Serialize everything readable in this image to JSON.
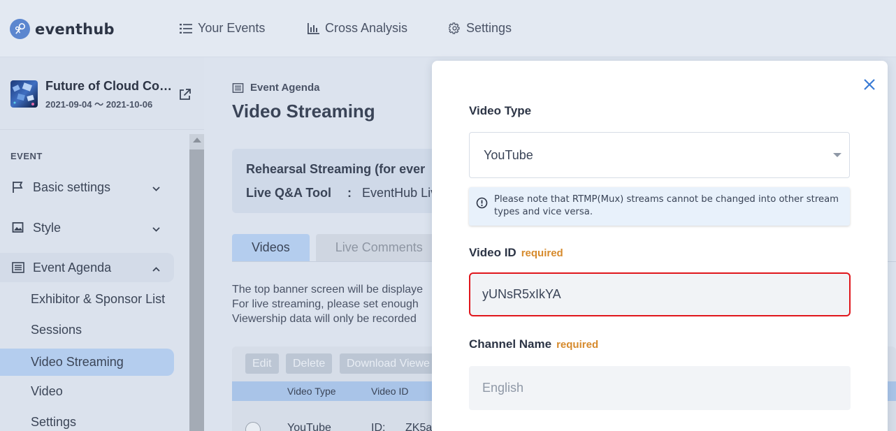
{
  "app": {
    "brand": "eventhub"
  },
  "nav": {
    "items": [
      {
        "label": "Your Events",
        "icon": "list-icon"
      },
      {
        "label": "Cross Analysis",
        "icon": "bar-chart-icon"
      },
      {
        "label": "Settings",
        "icon": "gear-icon"
      }
    ]
  },
  "sidebar": {
    "event_title": "Future of Cloud Co…",
    "event_dates": "2021-09-04 ～ 2021-10-06",
    "section_label": "EVENT",
    "items": [
      {
        "label": "Basic settings",
        "icon": "flag-icon"
      },
      {
        "label": "Style",
        "icon": "image-icon"
      },
      {
        "label": "Event Agenda",
        "icon": "agenda-icon"
      }
    ],
    "sub_items": [
      "Exhibitor & Sponsor List",
      "Sessions",
      "Video Streaming",
      "Video",
      "Settings"
    ]
  },
  "main": {
    "breadcrumb": "Event Agenda",
    "title": "Video Streaming",
    "info": {
      "line1_label": "Rehearsal Streaming (for ever",
      "line2_label": "Live Q&A Tool",
      "line2_sep": ":",
      "line2_value": "EventHub Liv"
    },
    "tabs": [
      "Videos",
      "Live Comments"
    ],
    "description": [
      "The top banner screen will be displaye",
      "For live streaming, please set enough",
      "Viewership data will only be recorded"
    ],
    "table": {
      "buttons": [
        "Edit",
        "Delete",
        "Download Viewe"
      ],
      "headers": [
        "Video Type",
        "Video ID"
      ],
      "row": {
        "type": "YouTube",
        "id_prefix": "ID:",
        "id_value": "ZK5a"
      }
    }
  },
  "modal": {
    "video_type_label": "Video Type",
    "video_type_value": "YouTube",
    "note": "Please note that RTMP(Mux) streams cannot be changed into other stream types and vice versa.",
    "video_id_label": "Video ID",
    "video_id_required": "required",
    "video_id_value": "yUNsR5xIkYA",
    "channel_label": "Channel Name",
    "channel_required": "required",
    "channel_placeholder": "English"
  },
  "colors": {
    "accent": "#b4cdee",
    "required": "#d68a2c",
    "highlight_border": "#e0161c",
    "close_icon": "#3a7bd5"
  }
}
